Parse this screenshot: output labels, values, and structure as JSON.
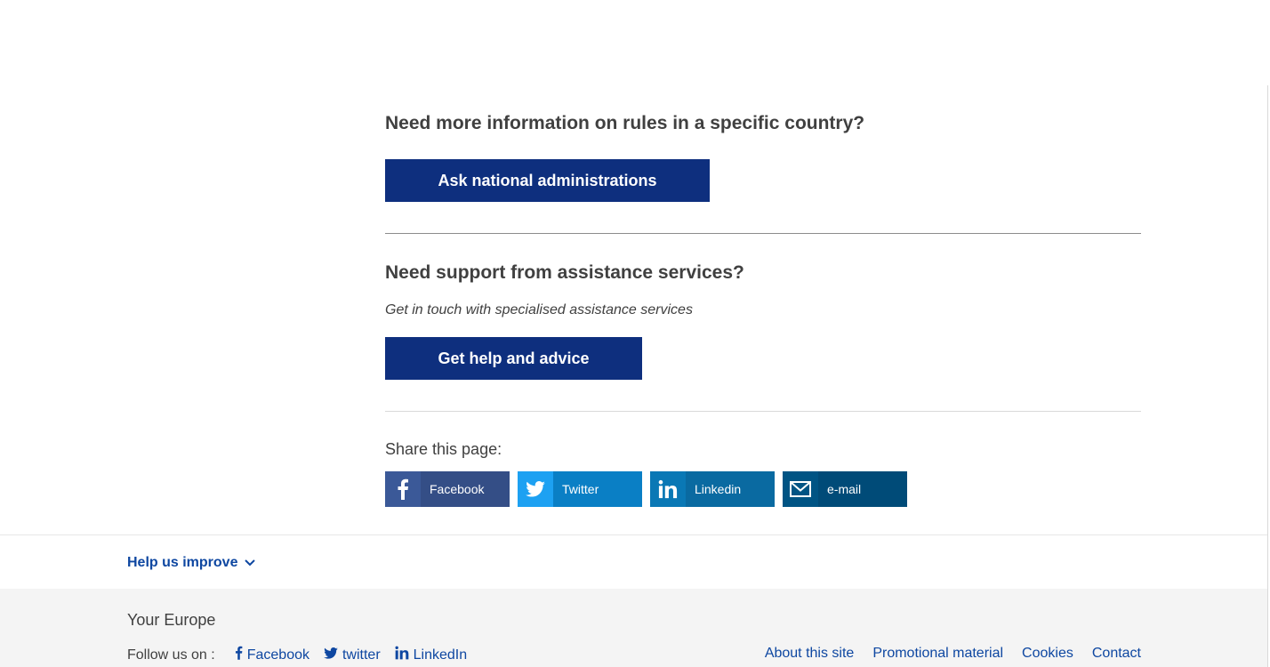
{
  "national": {
    "heading": "Need more information on rules in a specific country?",
    "button_label": "Ask national administrations"
  },
  "support": {
    "heading": "Need support from assistance services?",
    "subtext": "Get in touch with specialised assistance services",
    "button_label": "Get help and advice"
  },
  "share": {
    "label": "Share this page:",
    "buttons": [
      {
        "label": "Facebook",
        "icon": "facebook-icon"
      },
      {
        "label": "Twitter",
        "icon": "twitter-icon"
      },
      {
        "label": "Linkedin",
        "icon": "linkedin-icon"
      },
      {
        "label": "e-mail",
        "icon": "email-icon"
      }
    ]
  },
  "help": {
    "label": "Help us improve",
    "icon": "chevron-down-icon"
  },
  "footer": {
    "title": "Your Europe",
    "follow_label": "Follow us on :",
    "social": [
      {
        "label": "Facebook",
        "icon": "facebook-icon"
      },
      {
        "label": "twitter",
        "icon": "twitter-icon"
      },
      {
        "label": "LinkedIn",
        "icon": "linkedin-icon"
      }
    ],
    "links": [
      "About this site",
      "Promotional material",
      "Cookies",
      "Contact"
    ]
  },
  "colors": {
    "primary_button": "#0e2f7e",
    "link": "#0e47a1",
    "text": "#404040",
    "footer_bg": "#f4f4f4"
  }
}
